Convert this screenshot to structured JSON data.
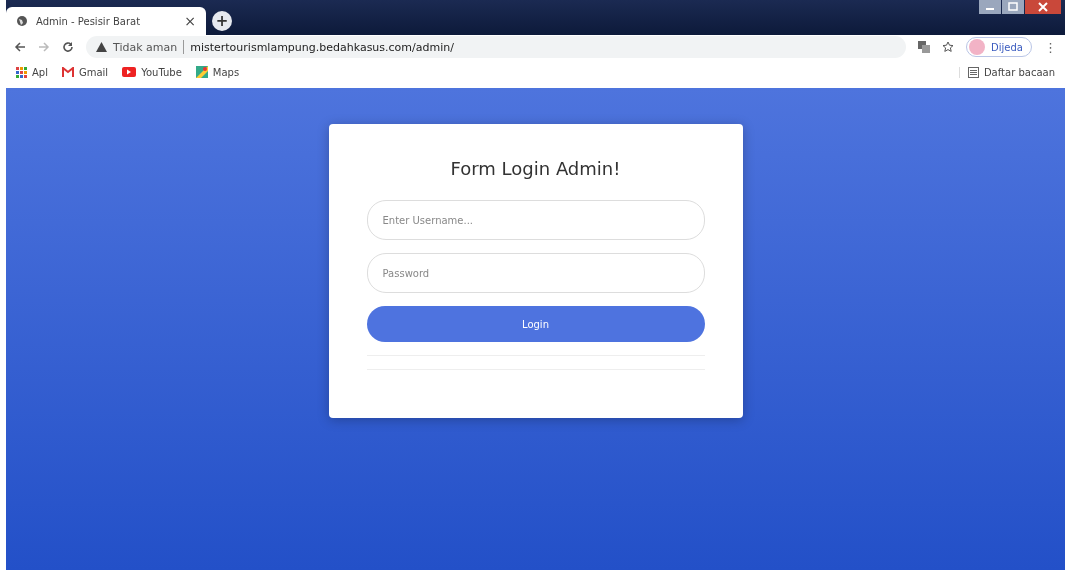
{
  "tab": {
    "title": "Admin - Pesisir Barat",
    "close": "×",
    "new_tab": "+"
  },
  "toolbar": {
    "security": "Tidak aman",
    "url": "mistertourismlampung.bedahkasus.com/admin/",
    "profile": "Dijeda",
    "menu": "⋮"
  },
  "bookmarks": [
    {
      "label": "Apl",
      "kind": "apps"
    },
    {
      "label": "Gmail",
      "kind": "gmail"
    },
    {
      "label": "YouTube",
      "kind": "youtube"
    },
    {
      "label": "Maps",
      "kind": "maps"
    }
  ],
  "reading_list": "Daftar bacaan",
  "login": {
    "title": "Form Login Admin!",
    "username_placeholder": "Enter Username...",
    "password_placeholder": "Password",
    "button": "Login"
  }
}
